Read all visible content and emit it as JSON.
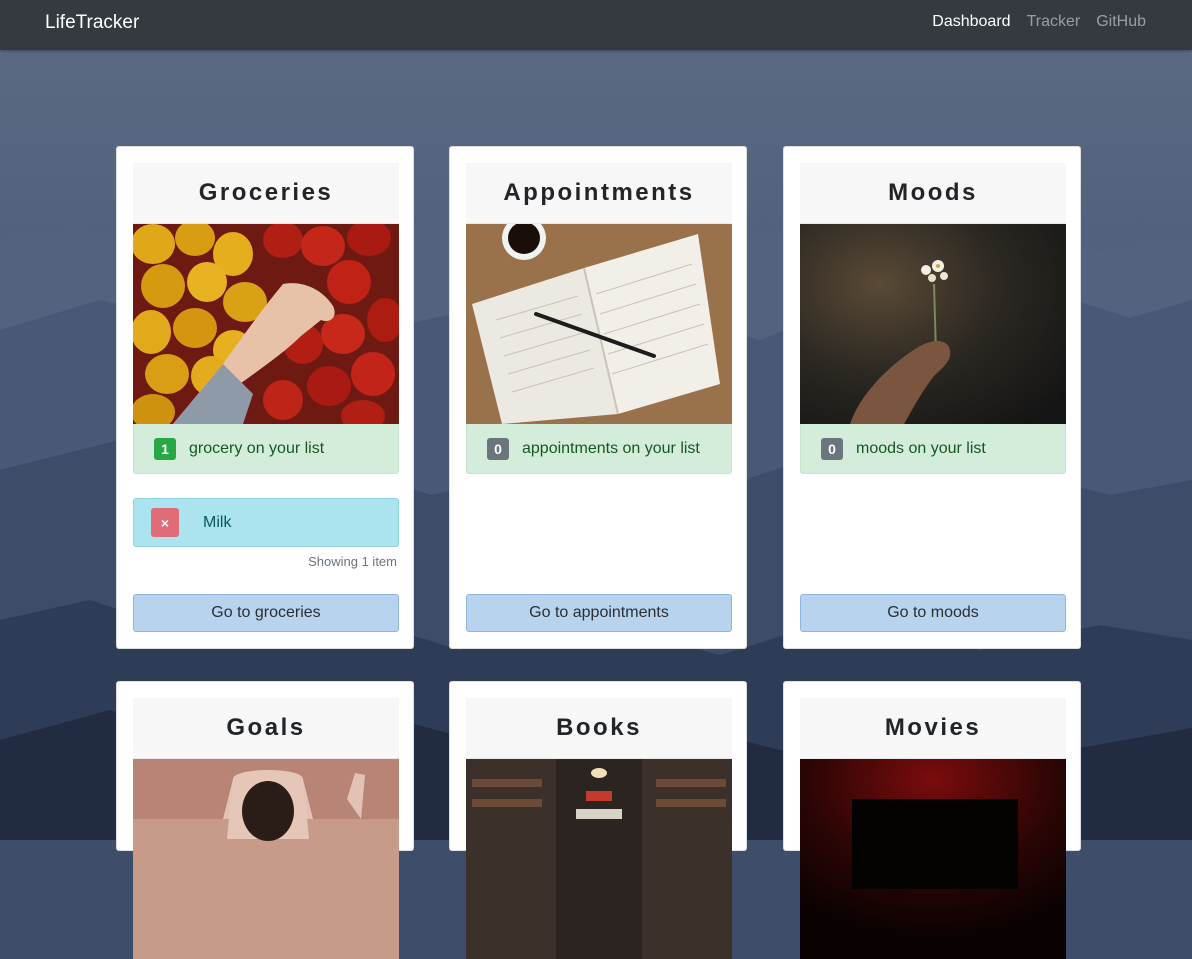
{
  "navbar": {
    "brand": "LifeTracker",
    "links": [
      {
        "label": "Dashboard",
        "active": true
      },
      {
        "label": "Tracker",
        "active": false
      },
      {
        "label": "GitHub",
        "active": false
      }
    ]
  },
  "cards": [
    {
      "title": "Groceries",
      "image": "peppers-photo",
      "count": "1",
      "count_text": "grocery on your list",
      "badge_color": "#28a745",
      "items": [
        {
          "label": "Milk",
          "delete_label": "×"
        }
      ],
      "showing": "Showing 1 item",
      "button": "Go to groceries"
    },
    {
      "title": "Appointments",
      "image": "notebook-photo",
      "count": "0",
      "count_text": "appointments on your list",
      "badge_color": "#6c757d",
      "button": "Go to appointments"
    },
    {
      "title": "Moods",
      "image": "flower-photo",
      "count": "0",
      "count_text": "moods on your list",
      "badge_color": "#6c757d",
      "button": "Go to moods"
    },
    {
      "title": "Goals",
      "image": "hand-coin-photo"
    },
    {
      "title": "Books",
      "image": "library-photo"
    },
    {
      "title": "Movies",
      "image": "cinema-photo"
    }
  ],
  "colors": {
    "navbar": "#343a40",
    "success_bg": "#d4edda",
    "info_bg": "#abe4ee",
    "button_bg": "#b7d3ee",
    "danger": "#e06c77"
  }
}
